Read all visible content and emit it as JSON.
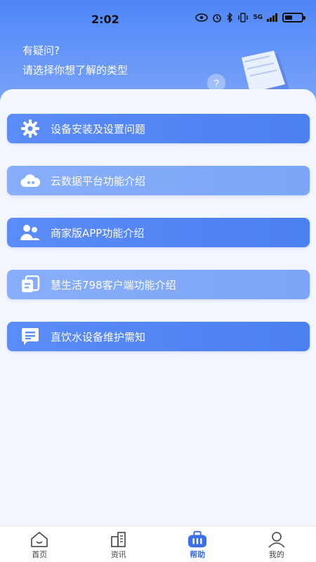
{
  "status": {
    "time": "2:02",
    "network": "5G"
  },
  "header": {
    "line1": "有疑问?",
    "line2": "请选择你想了解的类型"
  },
  "help_items": [
    {
      "label": "设备安装及设置问题",
      "icon": "gear-icon"
    },
    {
      "label": "云数据平台功能介绍",
      "icon": "cloud-icon"
    },
    {
      "label": "商家版APP功能介绍",
      "icon": "users-icon"
    },
    {
      "label": "慧生活798客户端功能介绍",
      "icon": "app-client-icon"
    },
    {
      "label": "直饮水设备维护需知",
      "icon": "message-notes-icon"
    }
  ],
  "tabs": [
    {
      "label": "首页",
      "icon": "home-icon"
    },
    {
      "label": "资讯",
      "icon": "buildings-icon"
    },
    {
      "label": "帮助",
      "icon": "help-bag-icon",
      "active": true
    },
    {
      "label": "我的",
      "icon": "person-icon"
    }
  ],
  "colors": {
    "accent": "#3a6fe8",
    "header": "#4f86f7"
  }
}
